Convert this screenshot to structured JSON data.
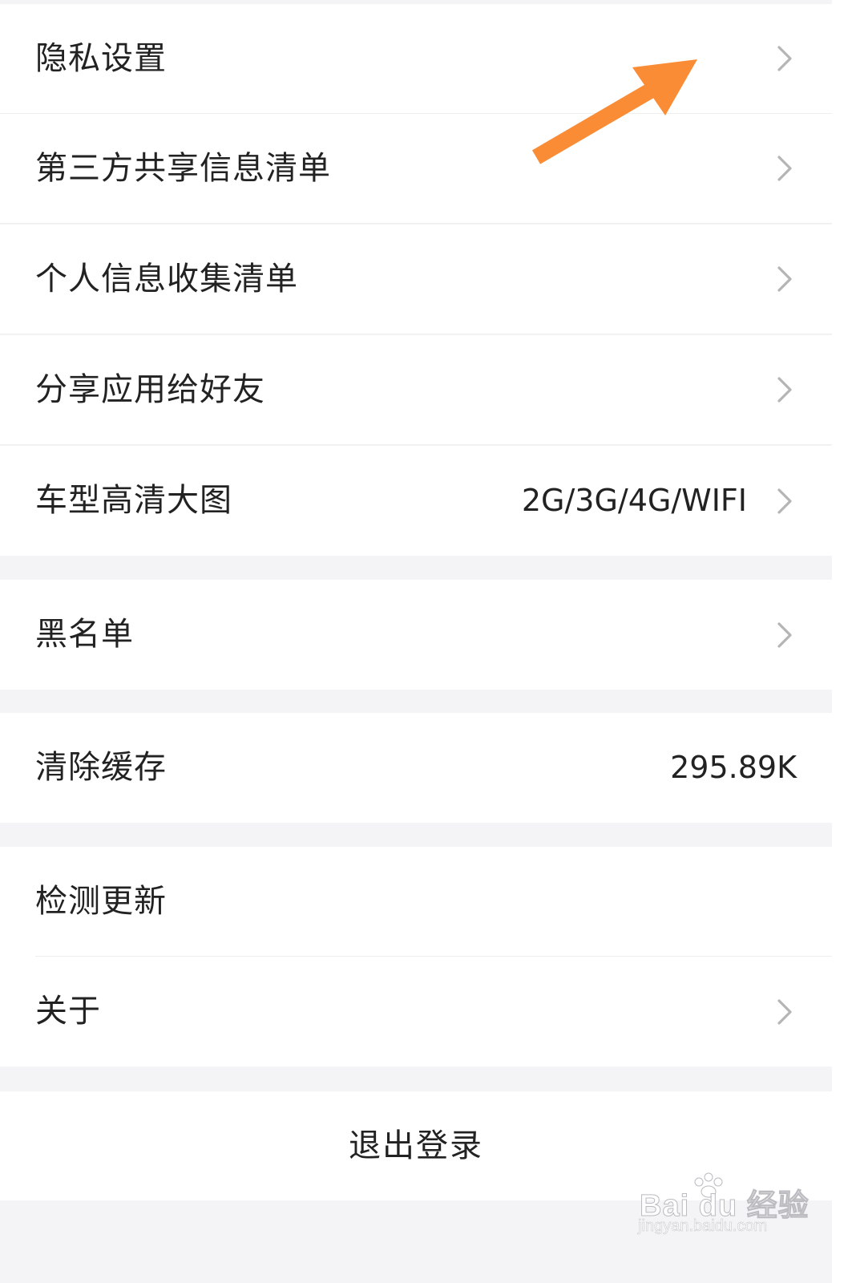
{
  "settings": {
    "items": [
      {
        "label": "隐私设置"
      },
      {
        "label": "第三方共享信息清单"
      },
      {
        "label": "个人信息收集清单"
      },
      {
        "label": "分享应用给好友"
      },
      {
        "label": "车型高清大图",
        "value": "2G/3G/4G/WIFI"
      },
      {
        "label": "黑名单"
      },
      {
        "label": "清除缓存",
        "value": "295.89K"
      },
      {
        "label": "检测更新"
      },
      {
        "label": "关于"
      }
    ],
    "logout_label": "退出登录"
  },
  "annotation": {
    "arrow_color": "#fa8c35"
  },
  "watermark": {
    "brand": "Bai du 经验",
    "url": "jingyan.baidu.com"
  },
  "icons": {
    "chevron": "chevron-right-icon",
    "arrow": "arrow-up-right-icon",
    "paw": "paw-icon"
  }
}
